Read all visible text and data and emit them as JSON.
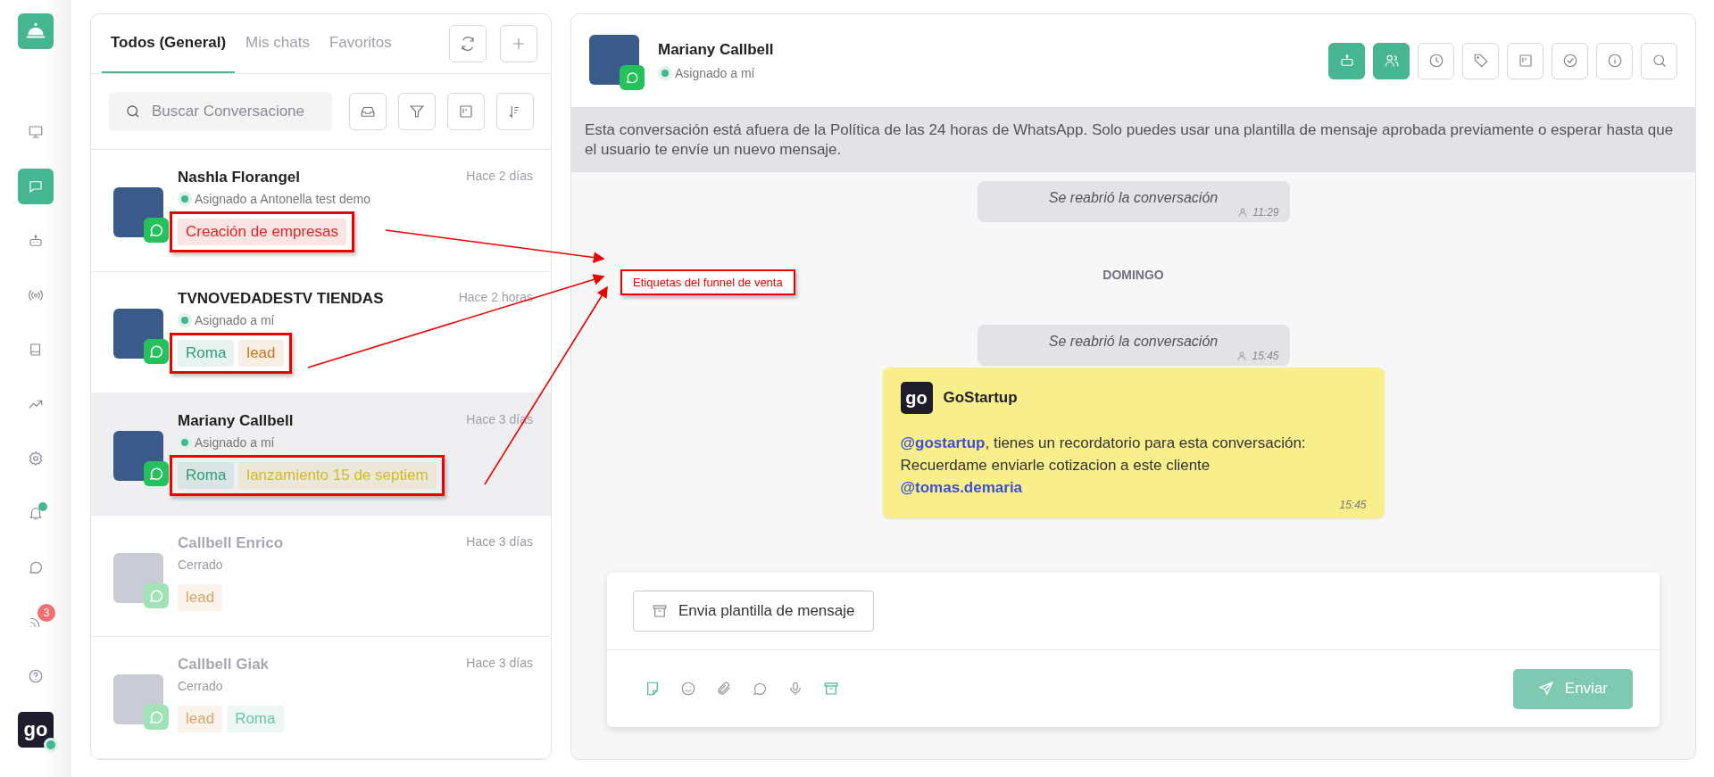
{
  "sidebar": {
    "items": [
      {
        "selected": false
      },
      {
        "selected": true
      },
      {
        "selected": false
      },
      {
        "selected": false
      },
      {
        "selected": false
      },
      {
        "selected": false
      },
      {
        "selected": false
      },
      {
        "selected": false,
        "dot": true
      },
      {
        "selected": false
      },
      {
        "selected": false,
        "badge": "3"
      },
      {
        "selected": false
      }
    ],
    "workspace_logo": "go",
    "online": true
  },
  "conversation_list": {
    "tabs": [
      {
        "label": "Todos (General)",
        "selected": true
      },
      {
        "label": "Mis chats",
        "selected": false
      },
      {
        "label": "Favoritos",
        "selected": false
      }
    ],
    "search": {
      "placeholder": "Buscar Conversacione"
    },
    "conversations": [
      {
        "name": "Nashla Florangel",
        "status": "Asignado a Antonella test demo",
        "time": "Hace 2 días",
        "closed": false,
        "selected": false,
        "annotated": true,
        "tags": [
          {
            "label": "Creación de empresas",
            "color": "#e02424"
          }
        ]
      },
      {
        "name": "TVNOVEDADESTV TIENDAS",
        "status": "Asignado a mí",
        "time": "Hace 2 horas",
        "closed": false,
        "selected": false,
        "annotated": true,
        "tags": [
          {
            "label": "Roma",
            "color": "#2e9e7a"
          },
          {
            "label": "lead",
            "color": "#c8741a"
          }
        ]
      },
      {
        "name": "Mariany Callbell",
        "status": "Asignado a mí",
        "time": "Hace 3 días",
        "closed": false,
        "selected": true,
        "annotated": true,
        "tags": [
          {
            "label": "Roma",
            "color": "#2e9e7a"
          },
          {
            "label": "lanzamiento 15 de septiem",
            "color": "#d4b82a"
          }
        ]
      },
      {
        "name": "Callbell Enrico",
        "status": "Cerrado",
        "time": "Hace 3 días",
        "closed": true,
        "selected": false,
        "annotated": false,
        "tags": [
          {
            "label": "lead",
            "color": "#d9a46a"
          }
        ]
      },
      {
        "name": "Callbell Giak",
        "status": "Cerrado",
        "time": "Hace 3 días",
        "closed": true,
        "selected": false,
        "annotated": false,
        "tags": [
          {
            "label": "lead",
            "color": "#d9a46a"
          },
          {
            "label": "Roma",
            "color": "#6fc2a4"
          }
        ]
      }
    ]
  },
  "annotation": {
    "label": "Etiquetas del funnel de venta"
  },
  "chat": {
    "contact": {
      "name": "Mariany Callbell",
      "status": "Asignado a mí"
    },
    "actions": [
      {
        "active": true
      },
      {
        "active": true
      },
      {
        "active": false
      },
      {
        "active": false
      },
      {
        "active": false
      },
      {
        "active": false
      },
      {
        "active": false
      },
      {
        "active": false
      }
    ],
    "banner": "Esta conversación está afuera de la Política de las 24 horas de WhatsApp. Solo puedes usar una plantilla de mensaje aprobada previamente o esperar hasta que el usuario te envíe un nuevo mensaje.",
    "messages": [
      {
        "kind": "system",
        "text": "Se reabrió la conversación",
        "time": "11:29"
      },
      {
        "kind": "date",
        "text": "DOMINGO"
      },
      {
        "kind": "system",
        "text": "Se reabrió la conversación",
        "time": "15:45"
      },
      {
        "kind": "note",
        "sender": "GoStartup",
        "sender_logo": "go",
        "lines": [
          "**@gostartup**, tienes un recordatorio para esta conversación:",
          "Recuerdame enviarle cotizacion a este cliente",
          "**@tomas.demaria**"
        ],
        "time": "15:45"
      }
    ],
    "composer": {
      "template_button": "Envia plantilla de mensaje",
      "tools": [
        {
          "active": true
        },
        {
          "active": false
        },
        {
          "active": false
        },
        {
          "active": false
        },
        {
          "active": false
        },
        {
          "active": true
        }
      ],
      "send": {
        "label": "Enviar",
        "disabled": true
      }
    }
  }
}
